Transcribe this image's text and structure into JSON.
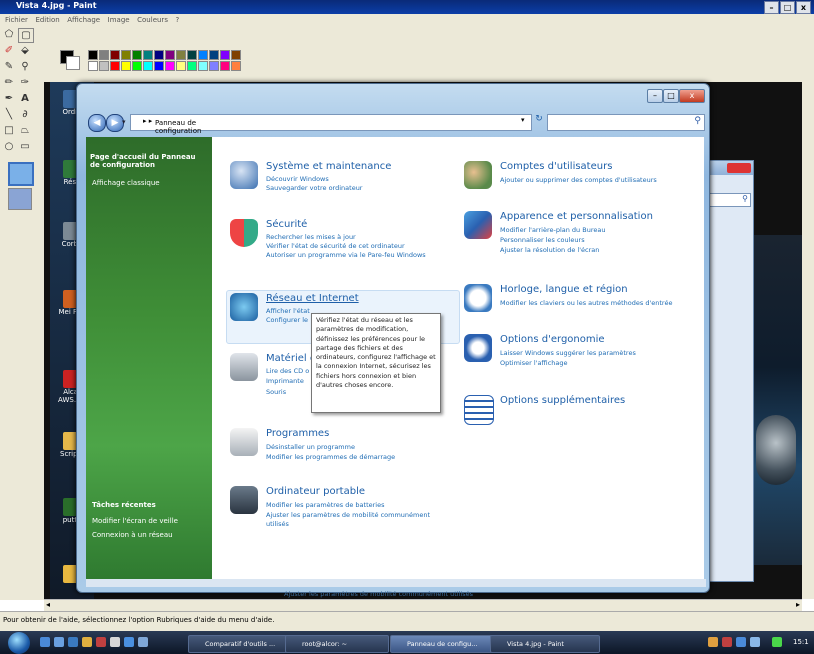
{
  "paint": {
    "title": "Vista 4.jpg - Paint",
    "menu": [
      "Fichier",
      "Edition",
      "Affichage",
      "Image",
      "Couleurs",
      "?"
    ],
    "status": "Pour obtenir de l'aide, sélectionnez l'option Rubriques d'aide du menu d'aide.",
    "palette_top": [
      "#000000",
      "#808080",
      "#800000",
      "#808000",
      "#008000",
      "#008080",
      "#000080",
      "#800080",
      "#808040",
      "#004040",
      "#0080ff",
      "#004080",
      "#8000ff",
      "#804000"
    ],
    "palette_bottom": [
      "#ffffff",
      "#c0c0c0",
      "#ff0000",
      "#ffff00",
      "#00ff00",
      "#00ffff",
      "#0000ff",
      "#ff00ff",
      "#ffff80",
      "#00ff80",
      "#80ffff",
      "#8080ff",
      "#ff0080",
      "#ff8040"
    ]
  },
  "desktop": {
    "icons": [
      "Ordin",
      "Rése",
      "Corbe",
      "Mei Fire",
      "Alcat AWS.sla",
      "Scripts",
      "putty"
    ]
  },
  "control_panel": {
    "address": "Panneau de configuration",
    "left_nav": {
      "home": "Page d'accueil du Panneau de configuration",
      "classic": "Affichage classique",
      "recent_title": "Tâches récentes",
      "recent1": "Modifier l'écran de veille",
      "recent2": "Connexion à un réseau"
    },
    "categories": {
      "system": {
        "title": "Système et maintenance",
        "links": [
          "Découvrir Windows",
          "Sauvegarder votre ordinateur"
        ]
      },
      "security": {
        "title": "Sécurité",
        "links": [
          "Rechercher les mises à jour",
          "Vérifier l'état de sécurité de cet ordinateur",
          "Autoriser un programme via le Pare-feu Windows"
        ]
      },
      "network": {
        "title": "Réseau et Internet",
        "links": [
          "Afficher l'état",
          "Configurer le"
        ]
      },
      "hardware": {
        "title": "Matériel e",
        "links": [
          "Lire des CD o",
          "Imprimante",
          "Souris"
        ]
      },
      "programs": {
        "title": "Programmes",
        "links": [
          "Désinstaller un programme",
          "Modifier les programmes de démarrage"
        ]
      },
      "laptop": {
        "title": "Ordinateur portable",
        "links": [
          "Modifier les paramètres de batteries",
          "Ajuster les paramètres de mobilité communément",
          "utilisés"
        ]
      },
      "users": {
        "title": "Comptes d'utilisateurs",
        "links": [
          "Ajouter ou supprimer des comptes d'utilisateurs"
        ]
      },
      "appearance": {
        "title": "Apparence et personnalisation",
        "links": [
          "Modifier l'arrière-plan du Bureau",
          "Personnaliser les couleurs",
          "Ajuster la résolution de l'écran"
        ]
      },
      "clock": {
        "title": "Horloge, langue et région",
        "links": [
          "Modifier les claviers ou les autres méthodes d'entrée"
        ]
      },
      "ease": {
        "title": "Options d'ergonomie",
        "links": [
          "Laisser Windows suggérer les paramètres",
          "Optimiser l'affichage"
        ]
      },
      "extra": {
        "title": "Options supplémentaires",
        "links": []
      }
    },
    "tooltip": [
      "Vérifiez l'état du réseau et les",
      "paramètres de modification,",
      "définissez les préférences pour le",
      "partage des fichiers et des",
      "ordinateurs, configurez l'affichage et",
      "la connexion Internet, sécurisez les",
      "fichiers hors connexion et bien",
      "d'autres choses encore."
    ],
    "bottom_text": "Ajuster les paramètres de mobilité communément utilisés"
  },
  "taskbar": {
    "tasks": [
      "Comparatif d'outils ...",
      "root@alcor: ~",
      "Panneau de configu...",
      "Vista 4.jpg - Paint"
    ],
    "clock": "15:1"
  }
}
